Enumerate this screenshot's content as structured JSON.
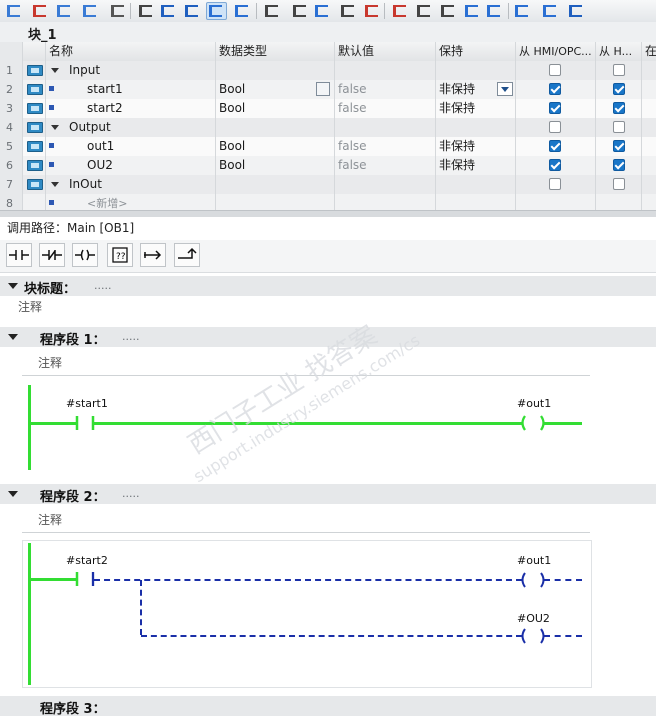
{
  "block": {
    "title": "块_1"
  },
  "grid": {
    "headers": {
      "name": "名称",
      "type": "数据类型",
      "default": "默认值",
      "retain": "保持",
      "hmi1": "从 HMI/OPC...",
      "hmi2": "从 H...",
      "more": "在"
    },
    "rows": [
      {
        "num": "1",
        "name": "Input",
        "kind": "section",
        "hmi1": false,
        "hmi2": false
      },
      {
        "num": "2",
        "name": "start1",
        "type": "Bool",
        "default": "false",
        "retain": "非保持",
        "hmi1": true,
        "hmi2": true
      },
      {
        "num": "3",
        "name": "start2",
        "type": "Bool",
        "default": "false",
        "retain": "非保持",
        "hmi1": true,
        "hmi2": true
      },
      {
        "num": "4",
        "name": "Output",
        "kind": "section",
        "hmi1": false,
        "hmi2": false
      },
      {
        "num": "5",
        "name": "out1",
        "type": "Bool",
        "default": "false",
        "retain": "非保持",
        "hmi1": true,
        "hmi2": true
      },
      {
        "num": "6",
        "name": "OU2",
        "type": "Bool",
        "default": "false",
        "retain": "非保持",
        "hmi1": true,
        "hmi2": true
      },
      {
        "num": "7",
        "name": "InOut",
        "kind": "section",
        "hmi1": false,
        "hmi2": false
      },
      {
        "num": "8",
        "name": "<新增>",
        "kind": "new"
      }
    ]
  },
  "call_path": "调用路径：Main [OB1]",
  "palette": {
    "items": [
      "normally-open-contact",
      "normally-closed-contact",
      "output-coil",
      "empty-box",
      "open-branch",
      "close-branch"
    ]
  },
  "block_title": {
    "label": "块标题：",
    "dots": ".....",
    "comment": "注释"
  },
  "networks": [
    {
      "label": "程序段 1：",
      "dots": ".....",
      "comment": "注释",
      "contact": "#start1",
      "coils": [
        "#out1"
      ]
    },
    {
      "label": "程序段 2：",
      "dots": ".....",
      "comment": "注释",
      "contact": "#start2",
      "coils": [
        "#out1",
        "#OU2"
      ]
    },
    {
      "label": "程序段 3："
    }
  ],
  "watermark": {
    "lines": [
      "西门子工业  找答案",
      "support.industry.siemens.com/cs"
    ]
  },
  "colors": {
    "energized": "#33dd33",
    "unpowered": "#1a2fa8",
    "checkbox": "#1976c8"
  }
}
